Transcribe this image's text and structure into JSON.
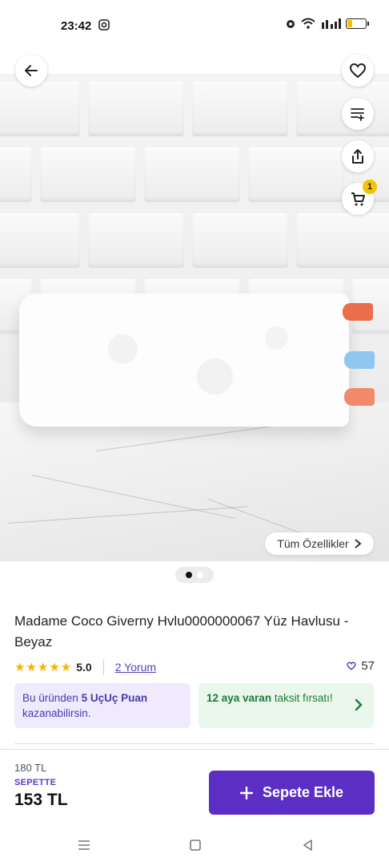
{
  "status": {
    "time": "23:42",
    "battery_level": 0.25
  },
  "gallery": {
    "all_features_label": "Tüm Özellikler",
    "cart_badge": "1",
    "page_count": 2,
    "active_index": 0
  },
  "product": {
    "title": "Madame Coco Giverny Hvlu0000000067 Yüz Havlusu - Beyaz",
    "rating_stars": "★★★★★",
    "rating": "5.0",
    "reviews": "2 Yorum",
    "likes": "57"
  },
  "promo": {
    "points_prefix": "Bu üründen ",
    "points_bold": "5 UçUç Puan",
    "points_suffix": " kazanabilirsin.",
    "installment_bold": "12 aya varan",
    "installment_rest": " taksit fırsatı!"
  },
  "pricing": {
    "old_price": "180 TL",
    "basket_label": "SEPETTE",
    "new_price": "153 TL",
    "add_to_cart": "Sepete Ekle"
  },
  "colors": {
    "accent": "#5b2fc4",
    "star": "#f4b400",
    "badge": "#f4c400",
    "installment_text": "#1f7a3a"
  },
  "icons": [
    "back-arrow-icon",
    "heart-icon",
    "filter-list-icon",
    "share-icon",
    "cart-icon",
    "chevron-right-icon",
    "plus-icon",
    "menu-icon",
    "home-square-icon",
    "back-triangle-icon"
  ]
}
